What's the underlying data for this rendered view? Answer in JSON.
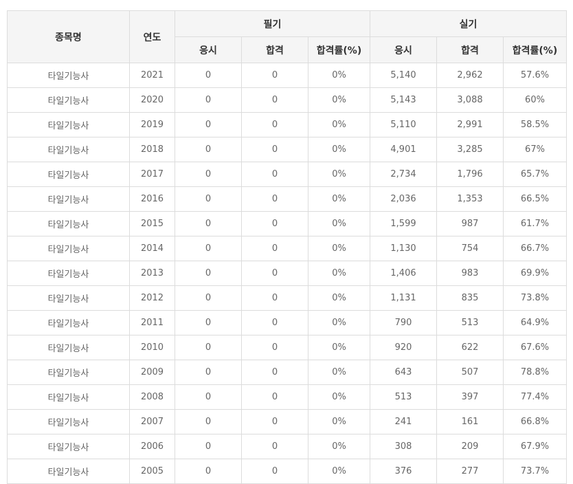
{
  "header": {
    "col_name": "종목명",
    "col_year": "연도",
    "group_written": "필기",
    "group_practical": "실기",
    "written": {
      "apply": "응시",
      "pass": "합격",
      "rate": "합격률(%)"
    },
    "practical": {
      "apply": "응시",
      "pass": "합격",
      "rate": "합격률(%)"
    }
  },
  "rows": [
    {
      "name": "타일기능사",
      "year": "2021",
      "w_apply": "0",
      "w_pass": "0",
      "w_rate": "0%",
      "p_apply": "5,140",
      "p_pass": "2,962",
      "p_rate": "57.6%"
    },
    {
      "name": "타일기능사",
      "year": "2020",
      "w_apply": "0",
      "w_pass": "0",
      "w_rate": "0%",
      "p_apply": "5,143",
      "p_pass": "3,088",
      "p_rate": "60%"
    },
    {
      "name": "타일기능사",
      "year": "2019",
      "w_apply": "0",
      "w_pass": "0",
      "w_rate": "0%",
      "p_apply": "5,110",
      "p_pass": "2,991",
      "p_rate": "58.5%"
    },
    {
      "name": "타일기능사",
      "year": "2018",
      "w_apply": "0",
      "w_pass": "0",
      "w_rate": "0%",
      "p_apply": "4,901",
      "p_pass": "3,285",
      "p_rate": "67%"
    },
    {
      "name": "타일기능사",
      "year": "2017",
      "w_apply": "0",
      "w_pass": "0",
      "w_rate": "0%",
      "p_apply": "2,734",
      "p_pass": "1,796",
      "p_rate": "65.7%"
    },
    {
      "name": "타일기능사",
      "year": "2016",
      "w_apply": "0",
      "w_pass": "0",
      "w_rate": "0%",
      "p_apply": "2,036",
      "p_pass": "1,353",
      "p_rate": "66.5%"
    },
    {
      "name": "타일기능사",
      "year": "2015",
      "w_apply": "0",
      "w_pass": "0",
      "w_rate": "0%",
      "p_apply": "1,599",
      "p_pass": "987",
      "p_rate": "61.7%"
    },
    {
      "name": "타일기능사",
      "year": "2014",
      "w_apply": "0",
      "w_pass": "0",
      "w_rate": "0%",
      "p_apply": "1,130",
      "p_pass": "754",
      "p_rate": "66.7%"
    },
    {
      "name": "타일기능사",
      "year": "2013",
      "w_apply": "0",
      "w_pass": "0",
      "w_rate": "0%",
      "p_apply": "1,406",
      "p_pass": "983",
      "p_rate": "69.9%"
    },
    {
      "name": "타일기능사",
      "year": "2012",
      "w_apply": "0",
      "w_pass": "0",
      "w_rate": "0%",
      "p_apply": "1,131",
      "p_pass": "835",
      "p_rate": "73.8%"
    },
    {
      "name": "타일기능사",
      "year": "2011",
      "w_apply": "0",
      "w_pass": "0",
      "w_rate": "0%",
      "p_apply": "790",
      "p_pass": "513",
      "p_rate": "64.9%"
    },
    {
      "name": "타일기능사",
      "year": "2010",
      "w_apply": "0",
      "w_pass": "0",
      "w_rate": "0%",
      "p_apply": "920",
      "p_pass": "622",
      "p_rate": "67.6%"
    },
    {
      "name": "타일기능사",
      "year": "2009",
      "w_apply": "0",
      "w_pass": "0",
      "w_rate": "0%",
      "p_apply": "643",
      "p_pass": "507",
      "p_rate": "78.8%"
    },
    {
      "name": "타일기능사",
      "year": "2008",
      "w_apply": "0",
      "w_pass": "0",
      "w_rate": "0%",
      "p_apply": "513",
      "p_pass": "397",
      "p_rate": "77.4%"
    },
    {
      "name": "타일기능사",
      "year": "2007",
      "w_apply": "0",
      "w_pass": "0",
      "w_rate": "0%",
      "p_apply": "241",
      "p_pass": "161",
      "p_rate": "66.8%"
    },
    {
      "name": "타일기능사",
      "year": "2006",
      "w_apply": "0",
      "w_pass": "0",
      "w_rate": "0%",
      "p_apply": "308",
      "p_pass": "209",
      "p_rate": "67.9%"
    },
    {
      "name": "타일기능사",
      "year": "2005",
      "w_apply": "0",
      "w_pass": "0",
      "w_rate": "0%",
      "p_apply": "376",
      "p_pass": "277",
      "p_rate": "73.7%"
    }
  ]
}
